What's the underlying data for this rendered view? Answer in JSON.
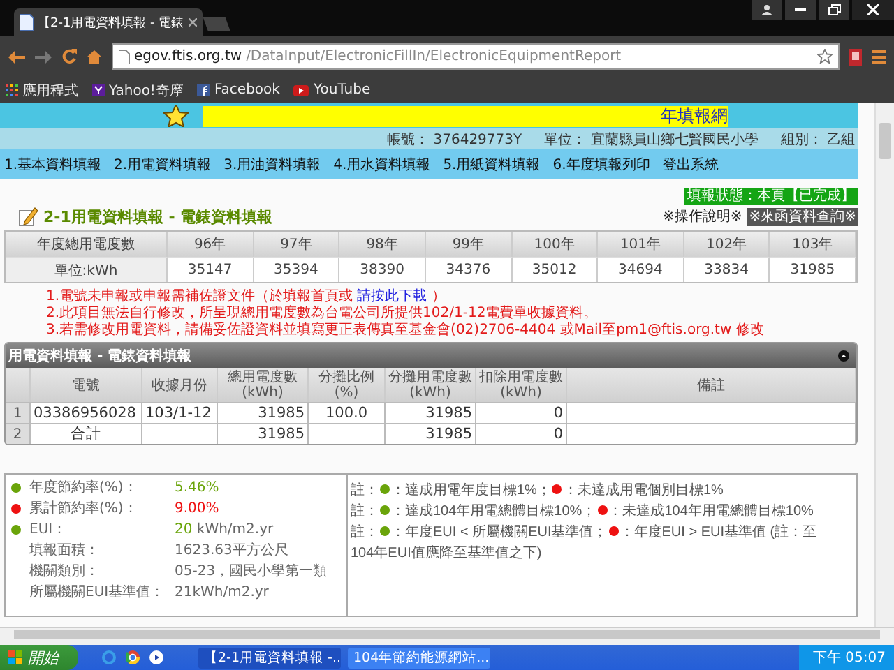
{
  "browser": {
    "tab_title": "【2-1用電資料填報 - 電錶",
    "url_host": "egov.ftis.org.tw",
    "url_path": "/DataInput/ElectronicFillIn/ElectronicEquipmentReport",
    "bookmarks": [
      {
        "kind": "apps",
        "label": "應用程式"
      },
      {
        "kind": "yahoo",
        "label": "Yahoo!奇摩"
      },
      {
        "kind": "facebook",
        "label": "Facebook"
      },
      {
        "kind": "youtube",
        "label": "YouTube"
      }
    ]
  },
  "banner": {
    "text": "年填報網"
  },
  "account": [
    {
      "label": "帳號：",
      "value": "376429773Y"
    },
    {
      "label": "單位：",
      "value": "宜蘭縣員山鄉七賢國民小學"
    },
    {
      "label": "組別：",
      "value": "乙組"
    }
  ],
  "menu": [
    "1.基本資料填報",
    "2.用電資料填報",
    "3.用油資料填報",
    "4.用水資料填報",
    "5.用紙資料填報",
    "6.年度填報列印",
    "登出系統"
  ],
  "status": "填報狀態：本頁【已完成】",
  "title": "2-1用電資料填報 - 電錶資料填報",
  "help_link": "※操作說明※",
  "query_button": "※來函資料查詢※",
  "yearly_table": {
    "header": "年度總用電度數",
    "years": [
      "96年",
      "97年",
      "98年",
      "99年",
      "100年",
      "101年",
      "102年",
      "103年"
    ],
    "row_label": "單位:kWh",
    "values": [
      "35147",
      "35394",
      "38390",
      "34376",
      "35012",
      "34694",
      "33834",
      "31985"
    ]
  },
  "notes": [
    {
      "text": "1.電號未申報或申報需補佐證文件（於填報首頁或 ",
      "link": "請按此下載",
      "after": " ）"
    },
    {
      "text": "2.此項目無法自行修改，所呈現總用電度數為台電公司所提供102/1-12電費單收據資料。"
    },
    {
      "text": "3.若需修改用電資料，請備妥佐證資料並填寫更正表傳真至基金會(02)2706-4404 或Mail至pm1@ftis.org.tw 修改"
    }
  ],
  "grid": {
    "title": "用電資料填報 - 電錶資料填報",
    "columns": [
      "電號",
      "收據月份",
      "總用電度數\n(kWh)",
      "分攤比例\n(%)",
      "分攤用電度數\n(kWh)",
      "扣除用電度數\n(kWh)",
      "備註"
    ],
    "rows": [
      {
        "num": "1",
        "cells": [
          "03386956028",
          "103/1-12",
          "31985",
          "100.0",
          "31985",
          "0",
          ""
        ]
      },
      {
        "num": "2",
        "cells": [
          "合計",
          "",
          "31985",
          "",
          "31985",
          "0",
          ""
        ]
      }
    ]
  },
  "summary": [
    {
      "label": "年度節約率(%)：",
      "value": "5.46%",
      "color": "#6aa40a"
    },
    {
      "label": "累計節約率(%)：",
      "value": "9.00%",
      "color": "#ee1111"
    },
    {
      "label": "EUI：",
      "value": "20",
      "unit": " kWh/m2.yr",
      "color": "#6aa40a"
    },
    {
      "label": "填報面積：",
      "value": "1623.63平方公尺"
    },
    {
      "label": "機關類別：",
      "value": "05-23，國民小學第一類"
    },
    {
      "label": "所屬機關EUI基準值：",
      "value": "21kWh/m2.yr"
    }
  ],
  "legend": [
    [
      {
        "kind": "text",
        "text": "註："
      },
      {
        "kind": "dot",
        "color": "#6aa40a"
      },
      {
        "kind": "text",
        "text": "：達成用電年度目標1%；"
      },
      {
        "kind": "dot",
        "color": "#ee1111"
      },
      {
        "kind": "text",
        "text": "：未達成用電個別目標1%"
      }
    ],
    [
      {
        "kind": "text",
        "text": "註："
      },
      {
        "kind": "dot",
        "color": "#6aa40a"
      },
      {
        "kind": "text",
        "text": "：達成104年用電總體目標10%；"
      },
      {
        "kind": "dot",
        "color": "#ee1111"
      },
      {
        "kind": "text",
        "text": "：未達成104年用電總體目標10%"
      }
    ],
    [
      {
        "kind": "text",
        "text": "註："
      },
      {
        "kind": "dot",
        "color": "#6aa40a"
      },
      {
        "kind": "text",
        "text": "：年度EUI < 所屬機關EUI基準值；"
      },
      {
        "kind": "dot",
        "color": "#ee1111"
      },
      {
        "kind": "text",
        "text": "：年度EUI > EUI基準值 (註：至"
      }
    ],
    [
      {
        "kind": "text",
        "text": "104年EUI值應降至基準值之下)"
      }
    ]
  ],
  "taskbar": {
    "start": "開始",
    "tasks": [
      {
        "label": "【2-1用電資料填報 -...",
        "selected": true
      },
      {
        "label": "104年節約能源網站...",
        "selected": false
      }
    ],
    "clock": "下午 05:07"
  }
}
